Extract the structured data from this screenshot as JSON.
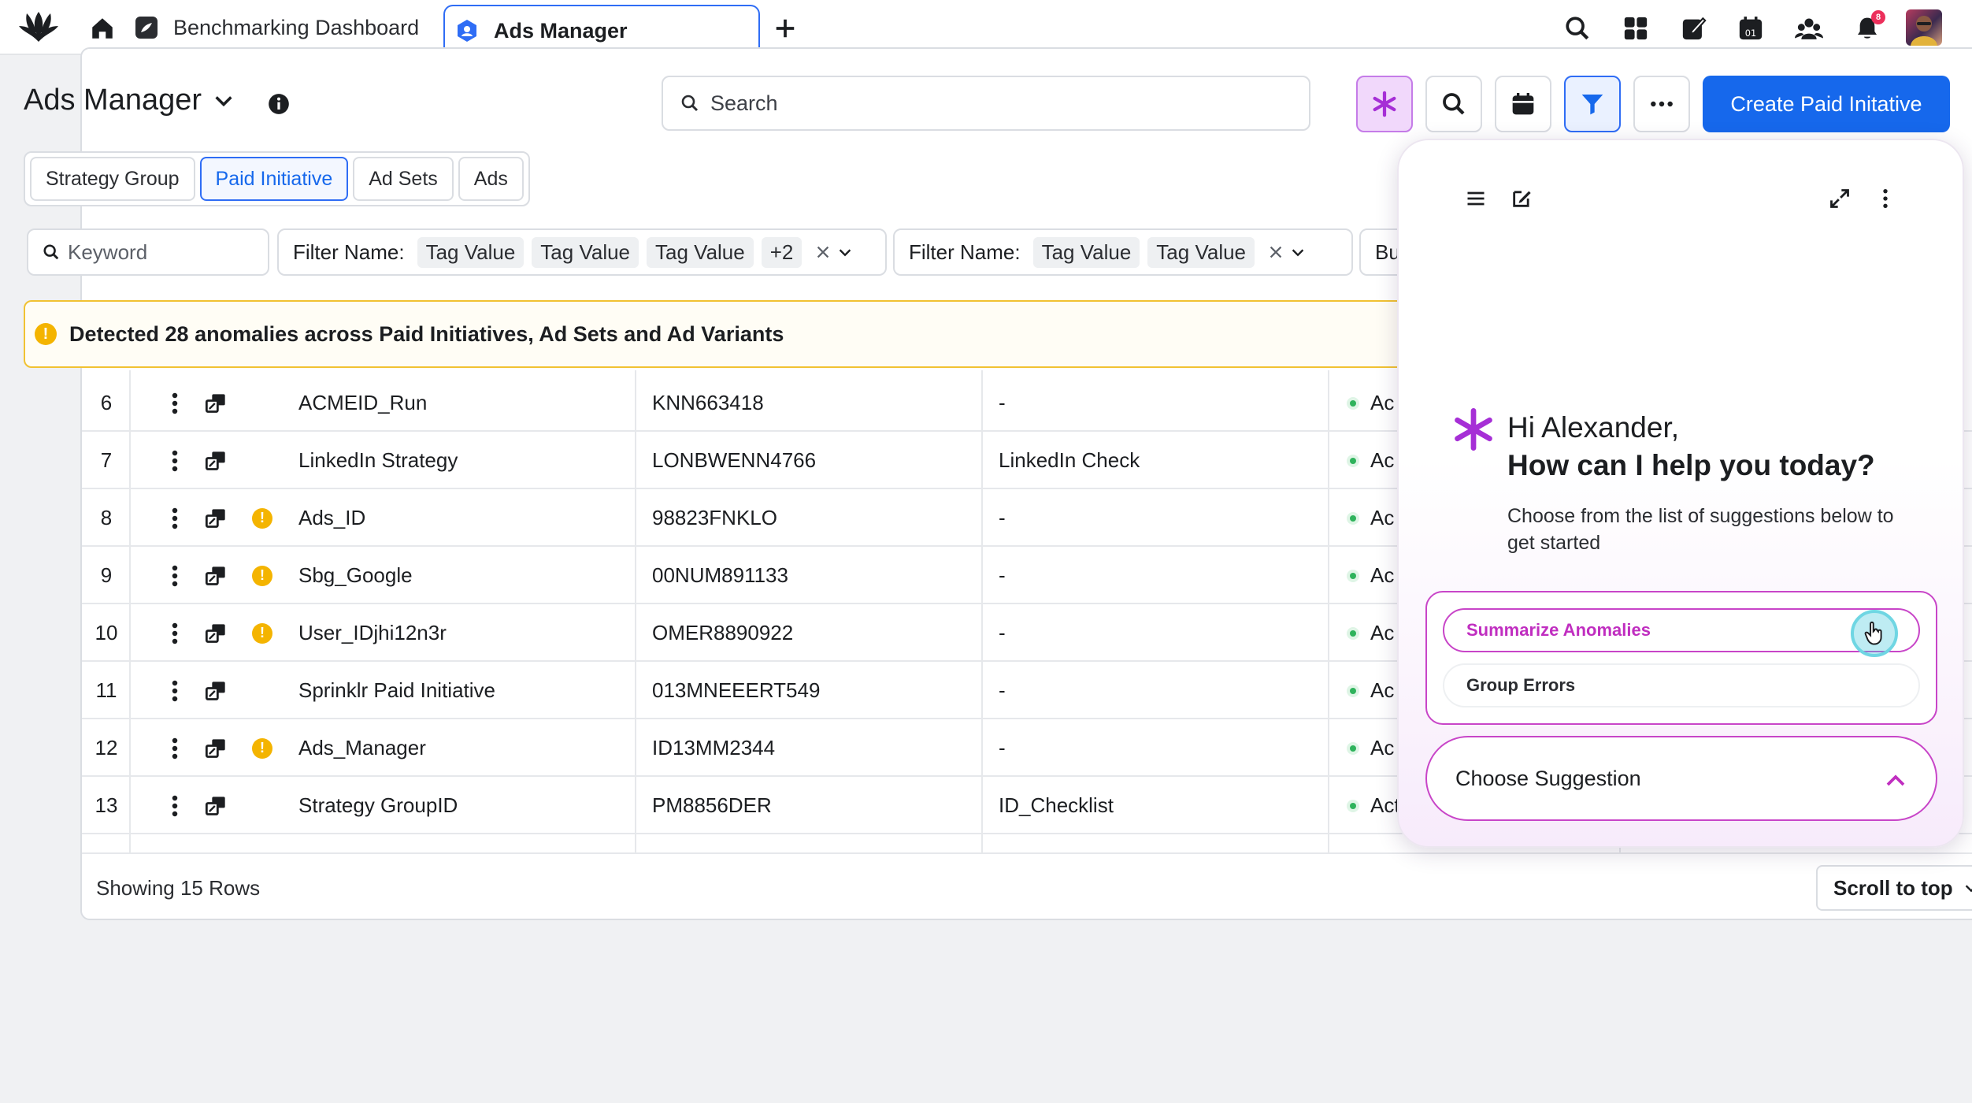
{
  "browser": {
    "tabs": [
      {
        "label": "Benchmarking Dashboard",
        "active": false
      },
      {
        "label": "Ads Manager",
        "active": true
      }
    ],
    "notification_count": "8"
  },
  "header": {
    "title": "Ads Manager",
    "search_placeholder": "Search",
    "create_label": "Create Paid Initative"
  },
  "entity_tabs": [
    "Strategy Group",
    "Paid Initiative",
    "Ad Sets",
    "Ads"
  ],
  "filters": {
    "keyword_placeholder": "Keyword",
    "chip1": {
      "name": "Filter Name:",
      "tags": [
        "Tag Value",
        "Tag Value",
        "Tag Value"
      ],
      "more": "+2"
    },
    "chip2": {
      "name": "Filter Name:",
      "tags": [
        "Tag Value",
        "Tag Value"
      ]
    },
    "chip3": {
      "name": "Budg"
    }
  },
  "banner": {
    "text": "Detected 28 anomalies across Paid Initiatives, Ad Sets and Ad Variants"
  },
  "table": {
    "rows": [
      {
        "num": "6",
        "warn": false,
        "name": "ACMEID_Run",
        "id": "KNN663418",
        "check": "-",
        "status": "Ac"
      },
      {
        "num": "7",
        "warn": false,
        "name": "LinkedIn Strategy",
        "id": "LONBWENN4766",
        "check": "LinkedIn Check",
        "status": "Ac"
      },
      {
        "num": "8",
        "warn": true,
        "name": "Ads_ID",
        "id": "98823FNKLO",
        "check": "-",
        "status": "Ac"
      },
      {
        "num": "9",
        "warn": true,
        "name": "Sbg_Google",
        "id": "00NUM891133",
        "check": "-",
        "status": "Ac"
      },
      {
        "num": "10",
        "warn": true,
        "name": "User_IDjhi12n3r",
        "id": "OMER8890922",
        "check": "-",
        "status": "Ac"
      },
      {
        "num": "11",
        "warn": false,
        "name": "Sprinklr Paid Initiative",
        "id": "013MNEEERT549",
        "check": "-",
        "status": "Ac"
      },
      {
        "num": "12",
        "warn": true,
        "name": "Ads_Manager",
        "id": "ID13MM2344",
        "check": "-",
        "status": "Ac"
      },
      {
        "num": "13",
        "warn": false,
        "name": "Strategy GroupID",
        "id": "PM8856DER",
        "check": "ID_Checklist",
        "status": "Act"
      }
    ],
    "footer_label": "Showing 15 Rows",
    "scroll_top_label": "Scroll to top"
  },
  "assistant": {
    "greeting": "Hi Alexander,",
    "question": "How can I help you today?",
    "subtitle": "Choose from the list of suggestions below to get started",
    "suggestions": [
      "Summarize Anomalies",
      "Group Errors"
    ],
    "choose_label": "Choose Suggestion"
  },
  "colors": {
    "primary": "#1668ec",
    "ai_accent": "#c845c8",
    "warning": "#f4b400",
    "success": "#2fb35c"
  },
  "icons": [
    "brand-logo-icon",
    "home-icon",
    "plus-icon",
    "search-icon",
    "apps-grid-icon",
    "compose-icon",
    "calendar-icon",
    "people-icon",
    "bell-icon",
    "info-icon",
    "sparkle-icon",
    "filter-icon",
    "more-horizontal-icon",
    "kebab-icon",
    "entity-type-icon",
    "warning-icon",
    "menu-icon",
    "expand-icon",
    "chevron-down-icon",
    "chevron-up-icon",
    "close-icon",
    "hand-cursor-icon"
  ]
}
